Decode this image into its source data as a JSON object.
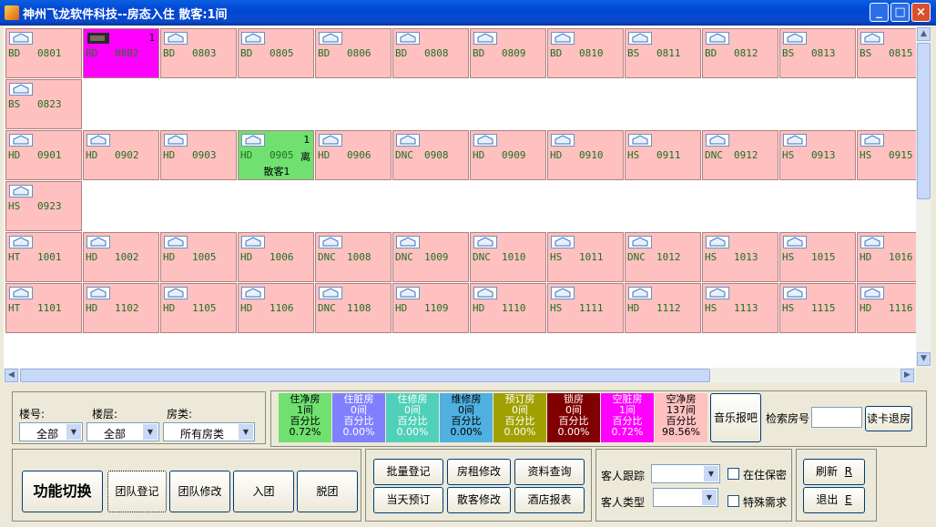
{
  "window": {
    "title": "神州飞龙软件科技--房态入住  散客:1间",
    "min": "_",
    "max": "□",
    "close": "×"
  },
  "rooms": [
    {
      "type": "BD",
      "num": "0801"
    },
    {
      "type": "BD",
      "num": "0802",
      "occupied": true,
      "count": "1"
    },
    {
      "type": "BD",
      "num": "0803"
    },
    {
      "type": "BD",
      "num": "0805"
    },
    {
      "type": "BD",
      "num": "0806"
    },
    {
      "type": "BD",
      "num": "0808"
    },
    {
      "type": "BD",
      "num": "0809"
    },
    {
      "type": "BD",
      "num": "0810"
    },
    {
      "type": "BS",
      "num": "0811"
    },
    {
      "type": "BD",
      "num": "0812"
    },
    {
      "type": "BS",
      "num": "0813"
    },
    {
      "type": "BS",
      "num": "0815"
    },
    {
      "type": "BS",
      "num": "0823"
    },
    {
      "type": "HD",
      "num": "0901"
    },
    {
      "type": "HD",
      "num": "0902"
    },
    {
      "type": "HD",
      "num": "0903"
    },
    {
      "type": "HD",
      "num": "0905",
      "guest_room": true,
      "count": "1",
      "flag": "离",
      "guest": "散客1"
    },
    {
      "type": "HD",
      "num": "0906"
    },
    {
      "type": "DNC",
      "num": "0908"
    },
    {
      "type": "HD",
      "num": "0909"
    },
    {
      "type": "HD",
      "num": "0910"
    },
    {
      "type": "HS",
      "num": "0911"
    },
    {
      "type": "DNC",
      "num": "0912"
    },
    {
      "type": "HS",
      "num": "0913"
    },
    {
      "type": "HS",
      "num": "0915"
    },
    {
      "type": "HS",
      "num": "0923"
    },
    {
      "type": "HT",
      "num": "1001"
    },
    {
      "type": "HD",
      "num": "1002"
    },
    {
      "type": "HD",
      "num": "1005"
    },
    {
      "type": "HD",
      "num": "1006"
    },
    {
      "type": "DNC",
      "num": "1008"
    },
    {
      "type": "DNC",
      "num": "1009"
    },
    {
      "type": "DNC",
      "num": "1010"
    },
    {
      "type": "HS",
      "num": "1011"
    },
    {
      "type": "DNC",
      "num": "1012"
    },
    {
      "type": "HS",
      "num": "1013"
    },
    {
      "type": "HS",
      "num": "1015"
    },
    {
      "type": "HD",
      "num": "1016"
    },
    {
      "type": "HT",
      "num": "1101"
    },
    {
      "type": "HD",
      "num": "1102"
    },
    {
      "type": "HD",
      "num": "1105"
    },
    {
      "type": "HD",
      "num": "1106"
    },
    {
      "type": "DNC",
      "num": "1108"
    },
    {
      "type": "HD",
      "num": "1109"
    },
    {
      "type": "HD",
      "num": "1110"
    },
    {
      "type": "HS",
      "num": "1111"
    },
    {
      "type": "HD",
      "num": "1112"
    },
    {
      "type": "HS",
      "num": "1113"
    },
    {
      "type": "HS",
      "num": "1115"
    },
    {
      "type": "HD",
      "num": "1116"
    }
  ],
  "filter": {
    "building_label": "楼号:",
    "building_value": "全部",
    "floor_label": "楼层:",
    "floor_value": "全部",
    "roomtype_label": "房类:",
    "roomtype_value": "所有房类"
  },
  "stats": [
    {
      "name": "住净房",
      "count": "1间",
      "pct_label": "百分比",
      "pct": "0.72%",
      "bg": "#70e070",
      "fg": "#000000"
    },
    {
      "name": "住脏房",
      "count": "0间",
      "pct_label": "百分比",
      "pct": "0.00%",
      "bg": "#8080ff",
      "fg": "#ffffff"
    },
    {
      "name": "住修房",
      "count": "0间",
      "pct_label": "百分比",
      "pct": "0.00%",
      "bg": "#50d0b8",
      "fg": "#ffffff"
    },
    {
      "name": "维修房",
      "count": "0间",
      "pct_label": "百分比",
      "pct": "0.00%",
      "bg": "#50b0e0",
      "fg": "#000000"
    },
    {
      "name": "预订房",
      "count": "0间",
      "pct_label": "百分比",
      "pct": "0.00%",
      "bg": "#a0a000",
      "fg": "#ffffff"
    },
    {
      "name": "锁房",
      "count": "0间",
      "pct_label": "百分比",
      "pct": "0.00%",
      "bg": "#800000",
      "fg": "#ffffff"
    },
    {
      "name": "空脏房",
      "count": "1间",
      "pct_label": "百分比",
      "pct": "0.72%",
      "bg": "#ff00ff",
      "fg": "#ffffff"
    },
    {
      "name": "空净房",
      "count": "137间",
      "pct_label": "百分比",
      "pct": "98.56%",
      "bg": "#ffc0c0",
      "fg": "#000000"
    }
  ],
  "music_bar": "音乐报吧",
  "search_label": "检索房号",
  "search_value": "",
  "card_checkout": "读卡退房",
  "left_buttons": {
    "switch": "功能切换",
    "group_register": "团队登记",
    "group_modify": "团队修改",
    "join_group": "入团",
    "leave_group": "脱团"
  },
  "mid_buttons": {
    "batch_register": "批量登记",
    "rent_modify": "房租修改",
    "info_query": "资料查询",
    "today_booking": "当天预订",
    "guest_modify": "散客修改",
    "hotel_report": "酒店报表"
  },
  "guest": {
    "track_label": "客人跟踪",
    "type_label": "客人类型",
    "confidential": "在住保密",
    "special": "特殊需求"
  },
  "right_buttons": {
    "refresh": "刷新",
    "refresh_key": "R",
    "exit": "退出",
    "exit_key": "E"
  }
}
